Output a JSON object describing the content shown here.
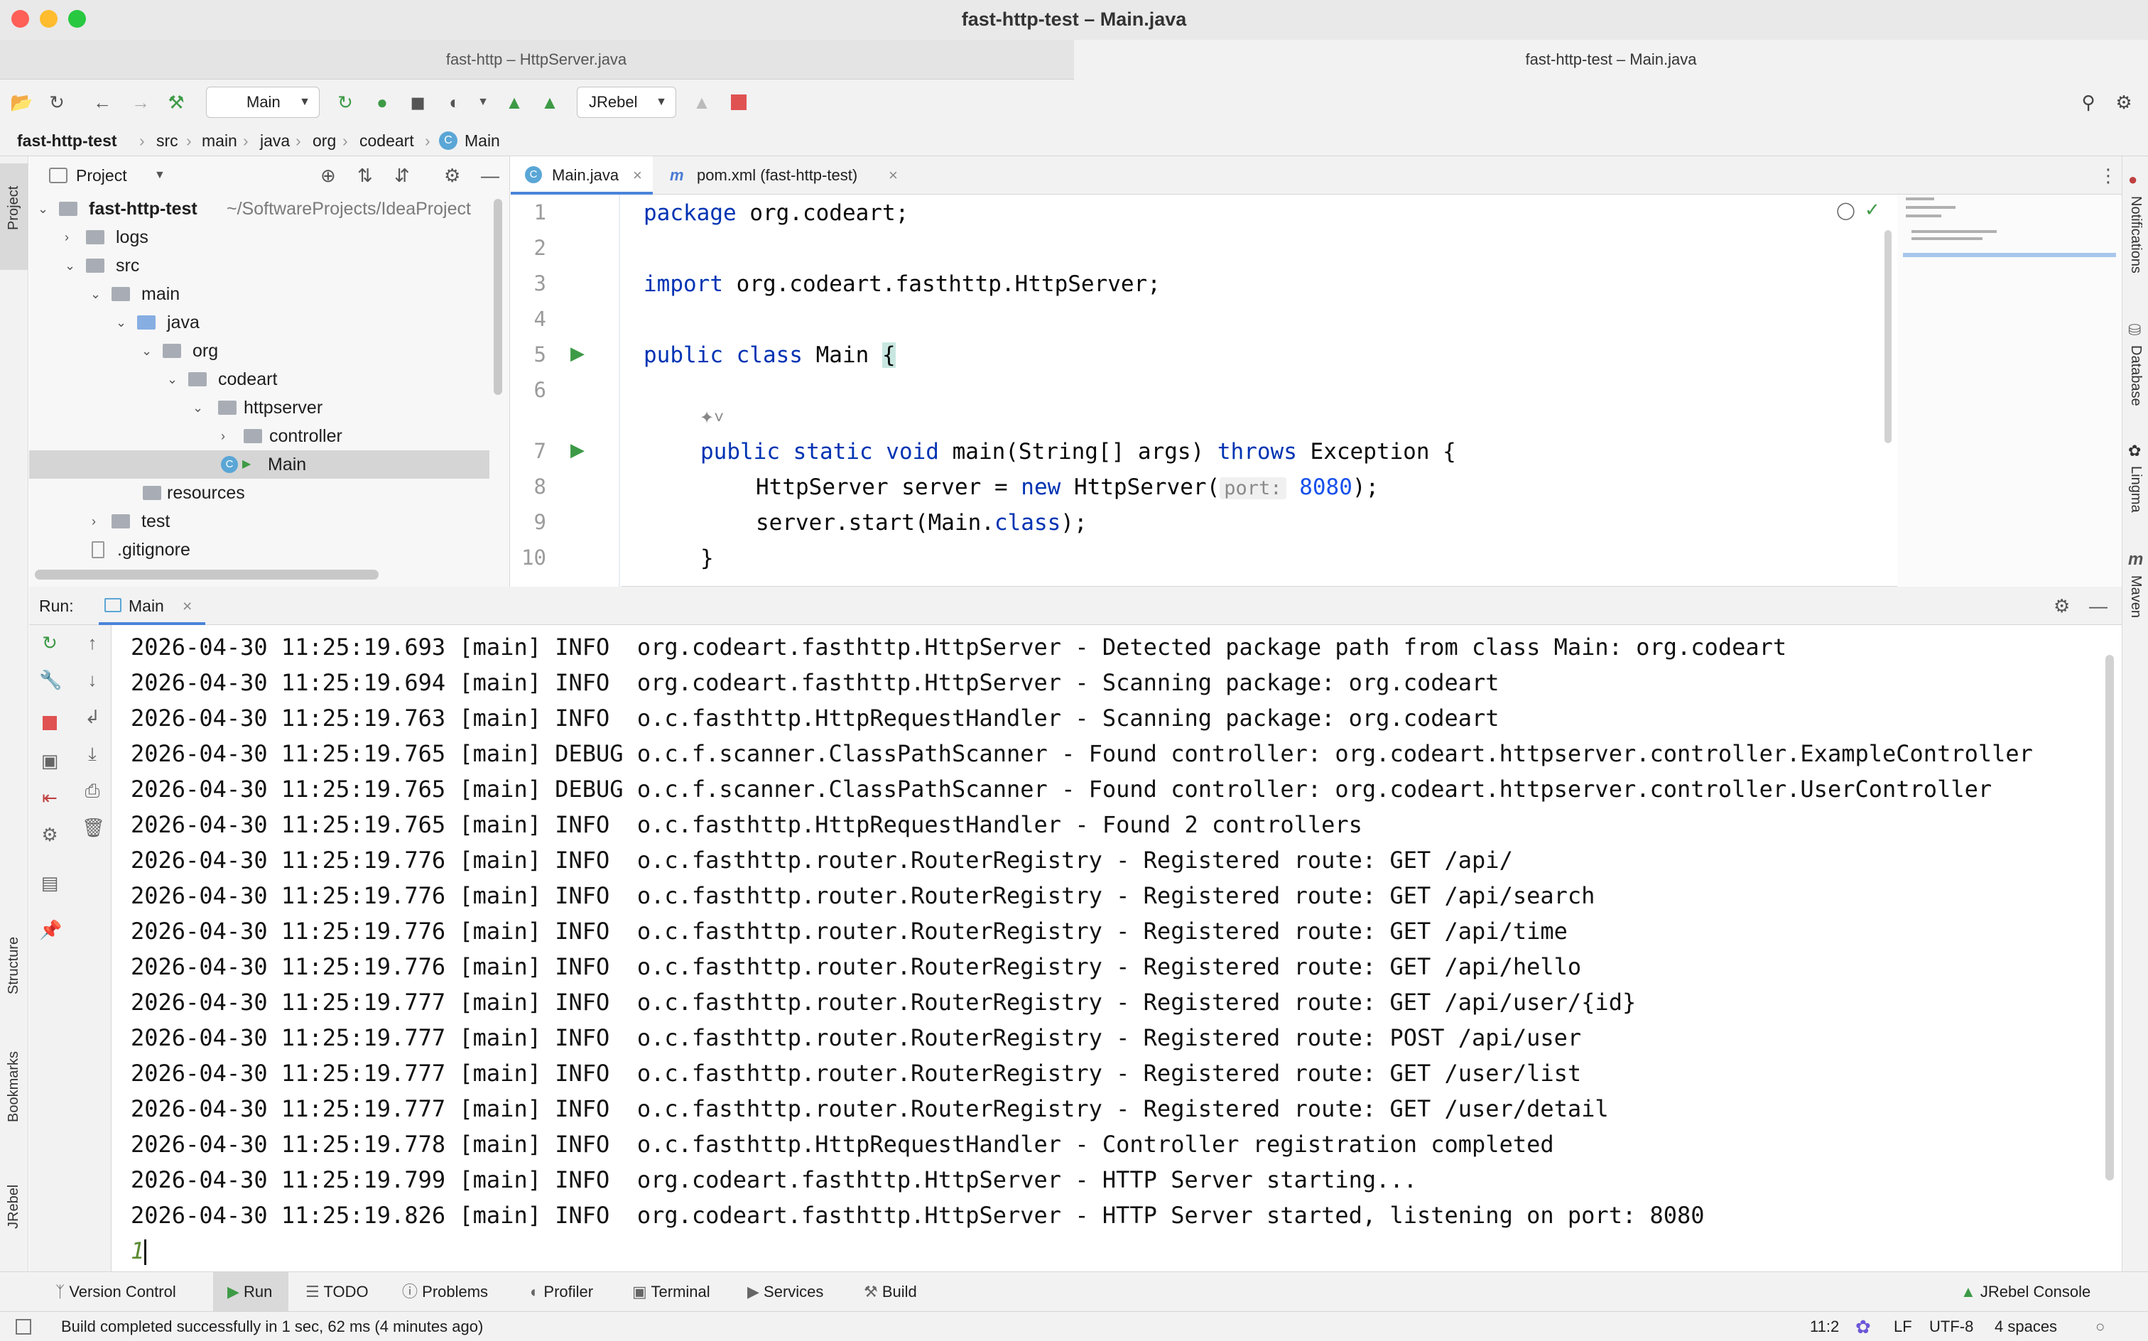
{
  "window": {
    "title": "fast-http-test – Main.java",
    "tabs": [
      "fast-http – HttpServer.java",
      "fast-http-test – Main.java"
    ]
  },
  "toolbar": {
    "run_config": "Main",
    "jrebel_config": "JRebel"
  },
  "breadcrumb": [
    "fast-http-test",
    "src",
    "main",
    "java",
    "org",
    "codeart",
    "Main"
  ],
  "project": {
    "header": "Project",
    "root_name": "fast-http-test",
    "root_path": "~/SoftwareProjects/IdeaProject",
    "items": [
      "logs",
      "src",
      "main",
      "java",
      "org",
      "codeart",
      "httpserver",
      "controller",
      "Main",
      "resources",
      "test",
      ".gitignore"
    ]
  },
  "editor": {
    "tabs": [
      "Main.java",
      "pom.xml (fast-http-test)"
    ],
    "line_numbers": [
      "1",
      "2",
      "3",
      "4",
      "5",
      "6",
      "7",
      "8",
      "9",
      "10"
    ],
    "code": {
      "l1_kw": "package",
      "l1_rest": " org.codeart;",
      "l3_kw": "import",
      "l3_rest": " org.codeart.fasthttp.HttpServer;",
      "l5_kw": "public class",
      "l5_rest": " Main ",
      "l5_brace": "{",
      "l7_kw1": "public static void",
      "l7_mid": " main(String[] args) ",
      "l7_kw2": "throws",
      "l7_rest": " Exception {",
      "l8_a": "HttpServer server = ",
      "l8_kw": "new",
      "l8_b": " HttpServer(",
      "l8_hint": "port:",
      "l8_num": "8080",
      "l8_c": ");",
      "l9_a": "server.start(Main.",
      "l9_kw": "class",
      "l9_b": ");",
      "l10": "}"
    }
  },
  "run": {
    "label": "Run:",
    "tab": "Main",
    "log": [
      "2026-04-30 11:25:19.693 [main] INFO  org.codeart.fasthttp.HttpServer - Detected package path from class Main: org.codeart",
      "2026-04-30 11:25:19.694 [main] INFO  org.codeart.fasthttp.HttpServer - Scanning package: org.codeart",
      "2026-04-30 11:25:19.763 [main] INFO  o.c.fasthttp.HttpRequestHandler - Scanning package: org.codeart",
      "2026-04-30 11:25:19.765 [main] DEBUG o.c.f.scanner.ClassPathScanner - Found controller: org.codeart.httpserver.controller.ExampleController",
      "2026-04-30 11:25:19.765 [main] DEBUG o.c.f.scanner.ClassPathScanner - Found controller: org.codeart.httpserver.controller.UserController",
      "2026-04-30 11:25:19.765 [main] INFO  o.c.fasthttp.HttpRequestHandler - Found 2 controllers",
      "2026-04-30 11:25:19.776 [main] INFO  o.c.fasthttp.router.RouterRegistry - Registered route: GET /api/",
      "2026-04-30 11:25:19.776 [main] INFO  o.c.fasthttp.router.RouterRegistry - Registered route: GET /api/search",
      "2026-04-30 11:25:19.776 [main] INFO  o.c.fasthttp.router.RouterRegistry - Registered route: GET /api/time",
      "2026-04-30 11:25:19.776 [main] INFO  o.c.fasthttp.router.RouterRegistry - Registered route: GET /api/hello",
      "2026-04-30 11:25:19.777 [main] INFO  o.c.fasthttp.router.RouterRegistry - Registered route: GET /api/user/{id}",
      "2026-04-30 11:25:19.777 [main] INFO  o.c.fasthttp.router.RouterRegistry - Registered route: POST /api/user",
      "2026-04-30 11:25:19.777 [main] INFO  o.c.fasthttp.router.RouterRegistry - Registered route: GET /user/list",
      "2026-04-30 11:25:19.777 [main] INFO  o.c.fasthttp.router.RouterRegistry - Registered route: GET /user/detail",
      "2026-04-30 11:25:19.778 [main] INFO  o.c.fasthttp.HttpRequestHandler - Controller registration completed",
      "2026-04-30 11:25:19.799 [main] INFO  org.codeart.fasthttp.HttpServer - HTTP Server starting...",
      "2026-04-30 11:25:19.826 [main] INFO  org.codeart.fasthttp.HttpServer - HTTP Server started, listening on port: 8080"
    ],
    "input_line": "1"
  },
  "left_stripe": [
    "Project",
    "Structure",
    "Bookmarks",
    "JRebel"
  ],
  "right_stripe": [
    "Notifications",
    "Database",
    "Lingma",
    "Maven"
  ],
  "bottom_tabs": [
    "Version Control",
    "Run",
    "TODO",
    "Problems",
    "Profiler",
    "Terminal",
    "Services",
    "Build",
    "JRebel Console"
  ],
  "status": {
    "message": "Build completed successfully in 1 sec, 62 ms (4 minutes ago)",
    "position": "11:2",
    "line_sep": "LF",
    "encoding": "UTF-8",
    "indent": "4 spaces"
  },
  "colors": {
    "close": "#fe5f57",
    "minimize": "#febc2e",
    "maximize": "#28c840",
    "run_green": "#3d9a46",
    "stop_red": "#e05252",
    "keyword": "#0033b3"
  }
}
